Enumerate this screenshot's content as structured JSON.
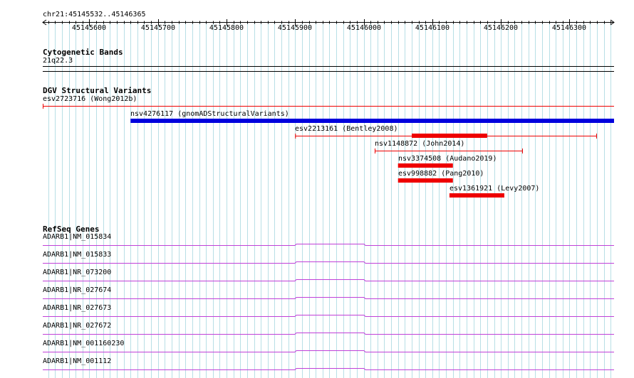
{
  "colors": {
    "grid": "#b8dfe6",
    "ruler": "#000000",
    "variant_loss": "#ee0000",
    "variant_gain": "#0000dd",
    "refseq": "#c040d8"
  },
  "ruler": {
    "location": "chr21:45145532..45146365",
    "start": 45145532,
    "end": 45146365,
    "ticks": [
      "45145600",
      "45145700",
      "45145800",
      "45145900",
      "45146000",
      "45146100",
      "45146200",
      "45146300"
    ]
  },
  "cytoband": {
    "title": "Cytogenetic Bands",
    "band": "21q22.3"
  },
  "dgv": {
    "title": "DGV Structural Variants",
    "variants": [
      {
        "label": "esv2723716 (Wong2012b)",
        "start": 45145532,
        "end": 45146365,
        "style": "thin",
        "color": "loss"
      },
      {
        "label": "nsv4276117 (gnomADStructuralVariants)",
        "start": 45145660,
        "end": 45146365,
        "style": "thick",
        "color": "gain"
      },
      {
        "label": "esv2213161 (Bentley2008)",
        "start": 45145900,
        "end": 45146340,
        "style": "thin",
        "color": "loss",
        "block_start": 45146070,
        "block_end": 45146180
      },
      {
        "label": "nsv1148872 (John2014)",
        "start": 45146016,
        "end": 45146232,
        "style": "thin",
        "color": "loss"
      },
      {
        "label": "nsv3374508 (Audano2019)",
        "start": 45146050,
        "end": 45146130,
        "style": "thick",
        "color": "loss"
      },
      {
        "label": "esv998882 (Pang2010)",
        "start": 45146050,
        "end": 45146130,
        "style": "thick",
        "color": "loss"
      },
      {
        "label": "esv1361921 (Levy2007)",
        "start": 45146125,
        "end": 45146205,
        "style": "thick",
        "color": "loss"
      }
    ]
  },
  "refseq": {
    "title": "RefSeq Genes",
    "genes": [
      {
        "label": "ADARB1|NM_015834"
      },
      {
        "label": "ADARB1|NM_015833"
      },
      {
        "label": "ADARB1|NR_073200"
      },
      {
        "label": "ADARB1|NR_027674"
      },
      {
        "label": "ADARB1|NR_027673"
      },
      {
        "label": "ADARB1|NR_027672"
      },
      {
        "label": "ADARB1|NM_001160230"
      },
      {
        "label": "ADARB1|NM_001112"
      }
    ]
  }
}
